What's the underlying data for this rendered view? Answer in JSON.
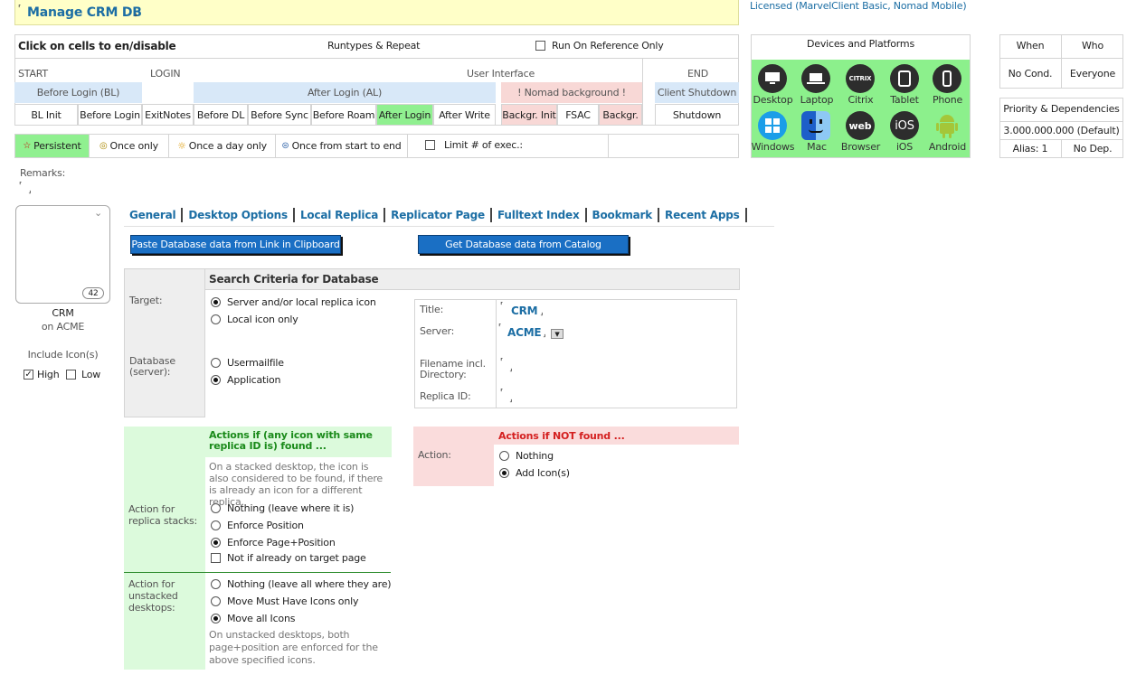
{
  "title": "Manage CRM DB",
  "license": "Licensed (MarvelClient Basic, Nomad Mobile)",
  "panel": {
    "header": "Click on cells to en/disable",
    "runtypes": "Runtypes & Repeat",
    "run_on_reference": "Run On Reference Only",
    "sections": {
      "start": "START",
      "login": "LOGIN",
      "ui": "User Interface",
      "end": "END"
    },
    "groups": {
      "before_login": "Before Login (BL)",
      "after_login": "After Login (AL)",
      "nomad_bg": "! Nomad background !",
      "client_shutdown": "Client Shutdown"
    },
    "cells": [
      "BL Init",
      "Before Login",
      "ExitNotes",
      "Before DL",
      "Before Sync",
      "Before Roam",
      "After Login",
      "After Write",
      "Backgr. Init",
      "FSAC",
      "Backgr.",
      "Shutdown"
    ]
  },
  "repeat": {
    "persistent": "Persistent",
    "once_only": "Once only",
    "once_a_day": "Once a day only",
    "once_start_end": "Once from start to end",
    "limit": "Limit # of exec.:"
  },
  "devices": {
    "header": "Devices and Platforms",
    "row1": [
      "Desktop",
      "Laptop",
      "Citrix",
      "Tablet",
      "Phone"
    ],
    "row2": [
      "Windows",
      "Mac",
      "Browser",
      "iOS",
      "Android"
    ],
    "badges": {
      "citrix": "CITRIX",
      "web": "web",
      "ios": "iOS"
    }
  },
  "when": {
    "label": "When",
    "value": "No Cond."
  },
  "who": {
    "label": "Who",
    "value": "Everyone"
  },
  "priority": {
    "label": "Priority & Dependencies",
    "value": "3.000.000.000 (Default)",
    "alias": "Alias: 1",
    "dep": "No Dep."
  },
  "remarks": "Remarks:",
  "dbicon": {
    "count": "42",
    "name": "CRM",
    "server": "on ACME",
    "include": "Include Icon(s)",
    "high": "High",
    "low": "Low"
  },
  "tabs": [
    "General",
    "Desktop Options",
    "Local Replica",
    "Replicator Page",
    "Fulltext Index",
    "Bookmark",
    "Recent Apps"
  ],
  "buttons": {
    "paste": "Paste Database data from Link in Clipboard",
    "catalog": "Get Database data from Catalog"
  },
  "search": {
    "header": "Search Criteria for Database",
    "target": "Target:",
    "server_local": "Server and/or local replica icon",
    "local_only": "Local icon only",
    "database": "Database (server):",
    "usermailfile": "Usermailfile",
    "application": "Application",
    "title_lbl": "Title:",
    "title_val": "CRM",
    "server_lbl": "Server:",
    "server_val": "ACME",
    "filename_lbl": "Filename incl. Directory:",
    "replica_lbl": "Replica ID:"
  },
  "found": {
    "header": "Actions if (any icon with same replica ID is) found ...",
    "note": "On a stacked desktop, the icon is also considered to be found, if there is already an icon for a different replica.",
    "stacks_lbl": "Action for replica stacks:",
    "nothing": "Nothing (leave where it is)",
    "enforce_pos": "Enforce Position",
    "enforce_page": "Enforce Page+Position",
    "not_if": "Not if already on target page",
    "unstacked_lbl": "Action for unstacked desktops:",
    "nothing_all": "Nothing (leave all where they are)",
    "move_must": "Move Must Have Icons only",
    "move_all": "Move all Icons",
    "unstacked_note": "On unstacked desktops, both page+position are enforced for the above specified icons."
  },
  "notfound": {
    "header": "Actions if NOT found ...",
    "action": "Action:",
    "nothing": "Nothing",
    "add": "Add Icon(s)"
  },
  "markers": {
    "open": "⸢",
    "close": "⸥"
  }
}
